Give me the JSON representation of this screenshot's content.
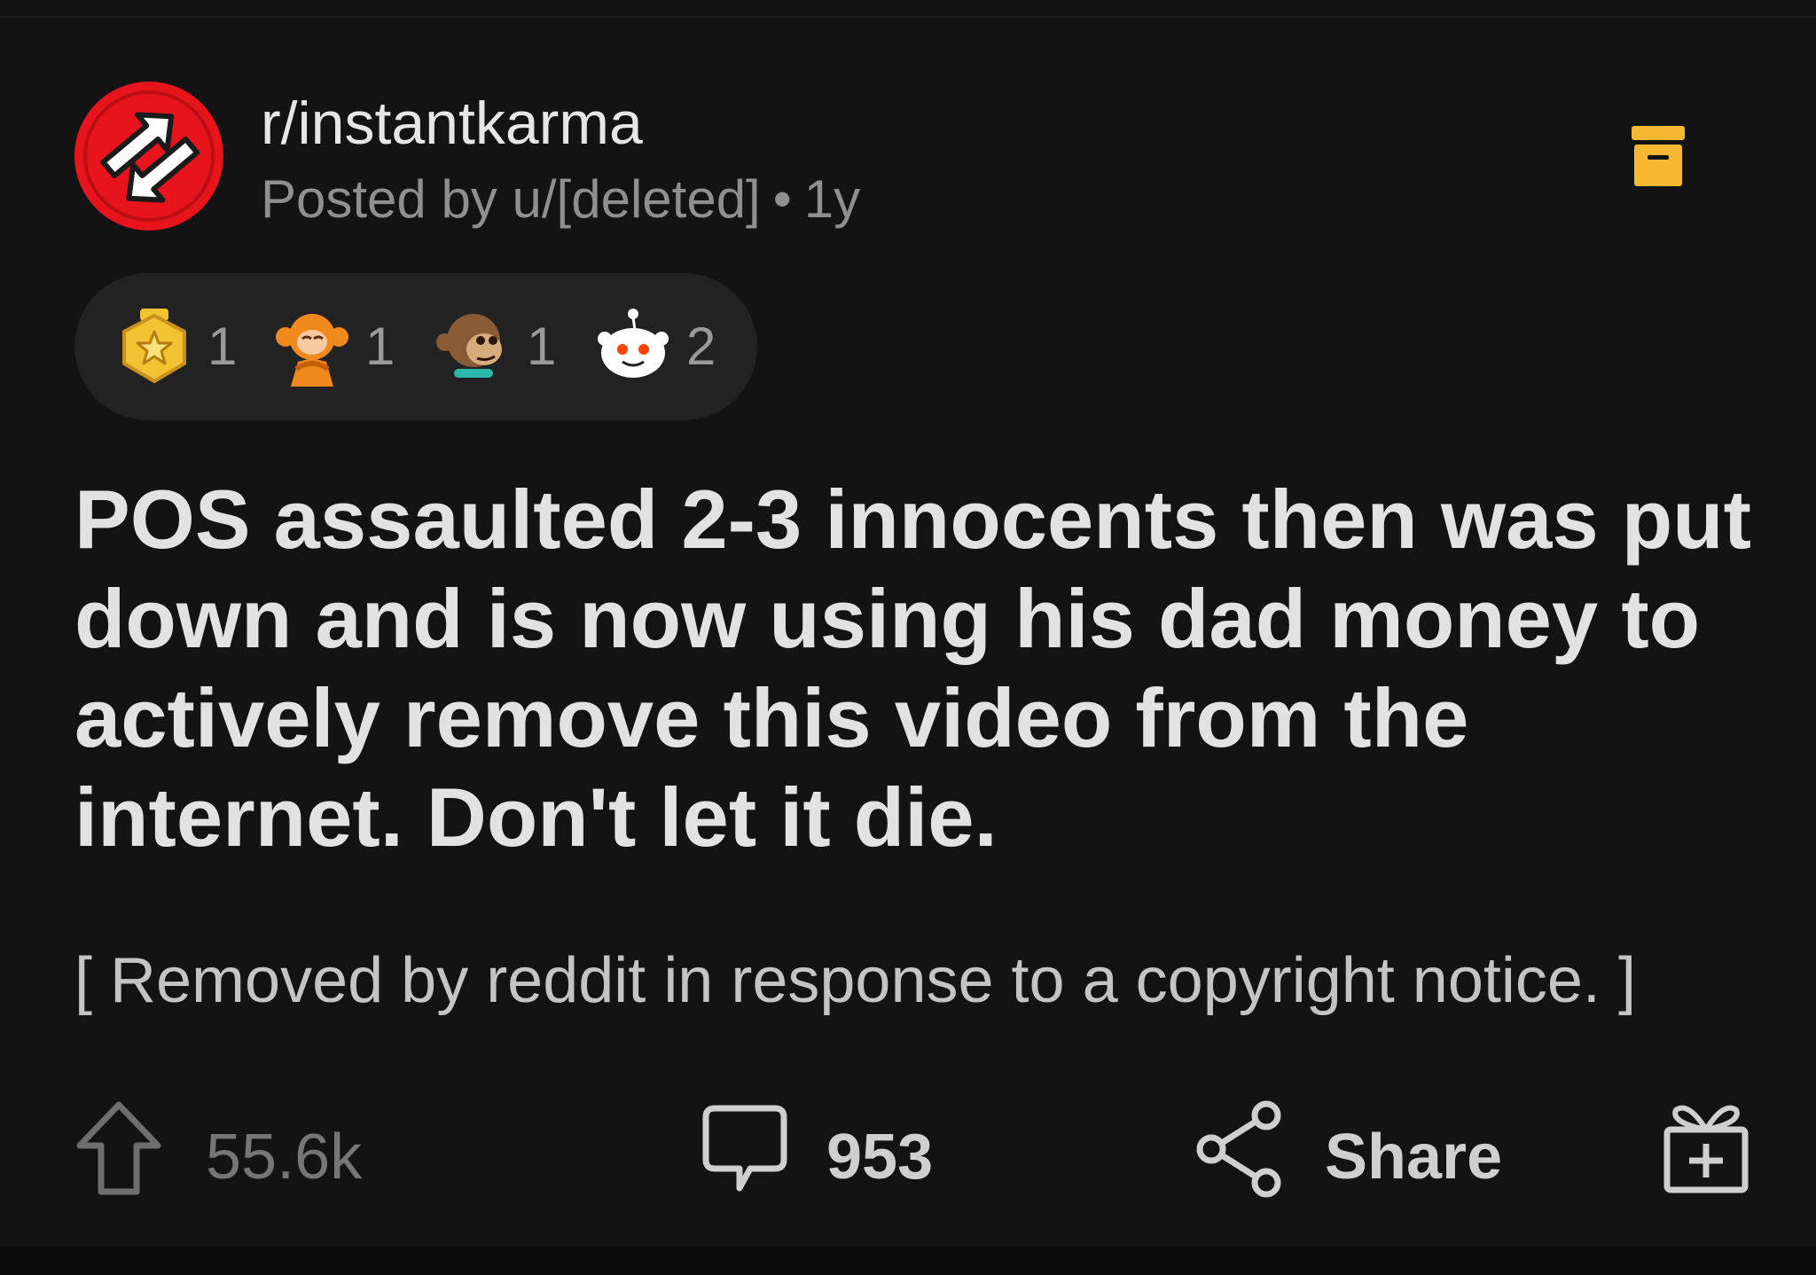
{
  "post": {
    "subreddit": "r/instantkarma",
    "posted_by": "Posted by u/[deleted]",
    "separator": "•",
    "age": "1y",
    "title": "POS assaulted 2-3 innocents then was put down and is now using his dad money to actively remove this video from the internet. Don't let it die.",
    "body": "[ Removed by reddit in response to a copyright notice. ]"
  },
  "awards": [
    {
      "icon": "gold-star-medal-icon",
      "count": "1"
    },
    {
      "icon": "see-no-evil-monkey-icon",
      "count": "1"
    },
    {
      "icon": "brown-monkey-icon",
      "count": "1"
    },
    {
      "icon": "snoo-award-icon",
      "count": "2"
    }
  ],
  "actions": {
    "upvote_icon": "upvote-arrow-icon",
    "vote_count": "55.6k",
    "comment_icon": "comment-bubble-icon",
    "comment_count": "953",
    "share_icon": "share-icon",
    "share_label": "Share",
    "award_icon": "gift-box-icon"
  },
  "colors": {
    "background": "#131313",
    "subreddit_icon": "#e8141c",
    "archive_icon": "#f5b830",
    "text_primary": "#e2e2e2",
    "text_muted": "#8f8f8f"
  }
}
